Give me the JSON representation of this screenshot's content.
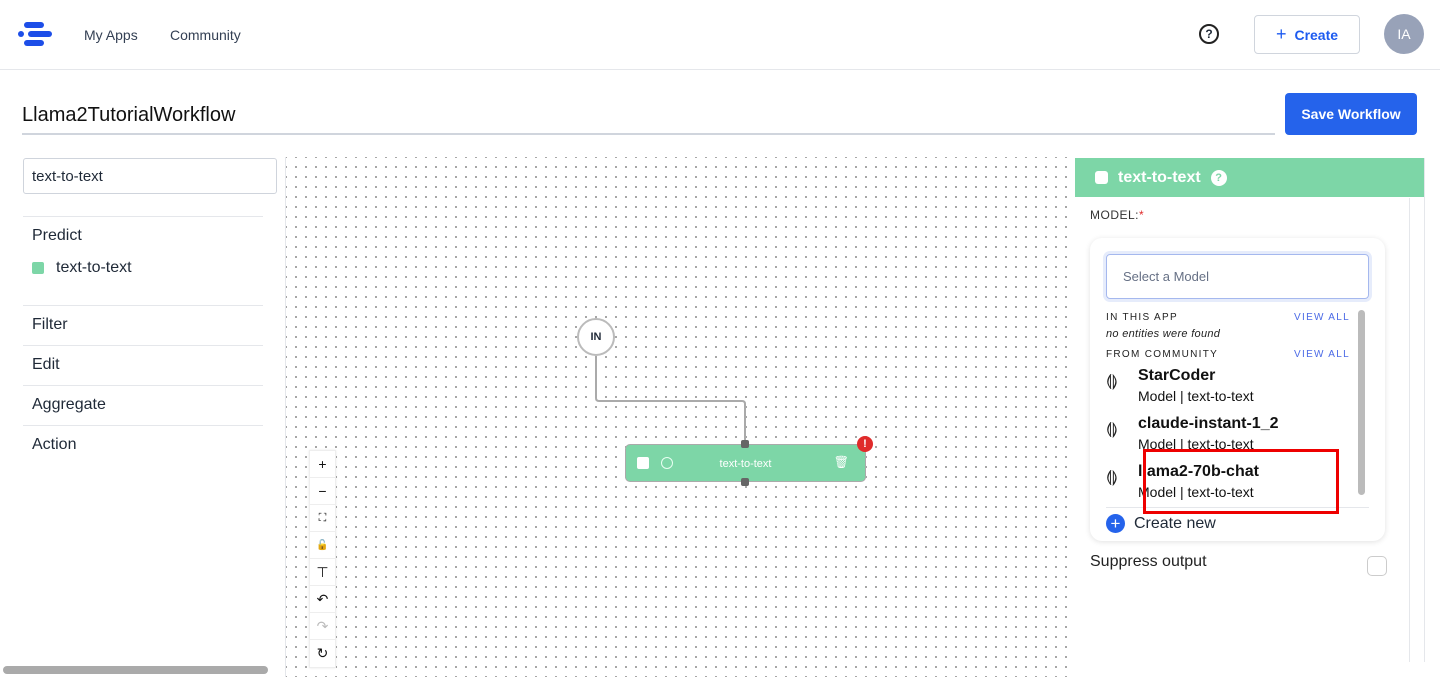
{
  "nav": {
    "my_apps": "My Apps",
    "community": "Community",
    "help": "?",
    "create": "Create",
    "create_icon": "+",
    "avatar": "IA"
  },
  "workflow": {
    "title": "Llama2TutorialWorkflow",
    "save": "Save Workflow"
  },
  "sidebar": {
    "search_value": "text-to-text",
    "predict": "Predict",
    "predict_item": "text-to-text",
    "items": [
      {
        "label": "Filter"
      },
      {
        "label": "Edit"
      },
      {
        "label": "Aggregate"
      },
      {
        "label": "Action"
      }
    ]
  },
  "canvas": {
    "in_node": "IN",
    "node_label": "text-to-text",
    "error_badge": "!",
    "controls": [
      "+",
      "−",
      "⛶",
      "🔓",
      "⊤",
      "↶",
      "↷",
      "↻"
    ]
  },
  "panel": {
    "title": "text-to-text",
    "help": "?",
    "model_label": "MODEL:",
    "required": "*",
    "select_placeholder": "Select a Model",
    "in_this_app": "IN THIS APP",
    "view_all": "VIEW ALL",
    "no_entities": "no entities were found",
    "from_community": "FROM COMMUNITY",
    "models": [
      {
        "name": "StarCoder",
        "sub": "Model | text-to-text"
      },
      {
        "name": "claude-instant-1_2",
        "sub": "Model | text-to-text"
      },
      {
        "name": "llama2-70b-chat",
        "sub": "Model | text-to-text"
      }
    ],
    "create_new": "Create new",
    "suppress": "Suppress output"
  },
  "colors": {
    "accent": "#2563eb",
    "node": "#7dd6a7",
    "highlight": "#ee0000"
  }
}
